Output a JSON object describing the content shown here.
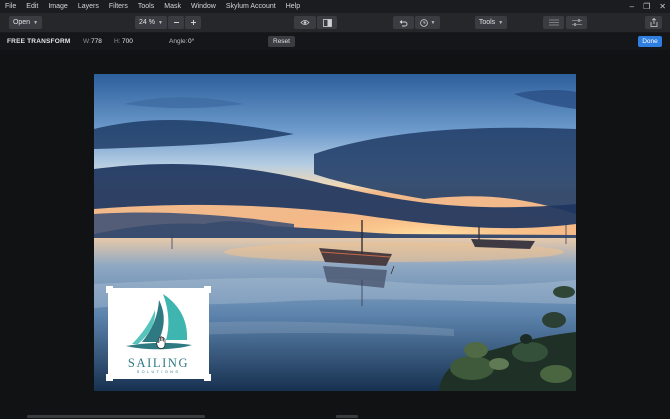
{
  "menu": [
    "File",
    "Edit",
    "Image",
    "Layers",
    "Filters",
    "Tools",
    "Mask",
    "Window",
    "Skylum Account",
    "Help"
  ],
  "window_controls": {
    "minimize": "–",
    "maximize": "❐",
    "close": "✕"
  },
  "toolbar": {
    "open_label": "Open",
    "zoom_value": "24 %",
    "tools_label": "Tools"
  },
  "transform": {
    "title": "FREE TRANSFORM",
    "w_label": "W:",
    "w_value": "778",
    "h_label": "H:",
    "h_value": "700",
    "angle_label": "Angle:",
    "angle_value": "0°",
    "reset_label": "Reset",
    "done_label": "Done"
  },
  "logo": {
    "title": "SAILING",
    "subtitle": "SOLUTIONS",
    "color": "#2f7a82",
    "accent": "#3fb5b0"
  },
  "colors": {
    "accent_blue": "#2f7fe0",
    "app_background": "#111214",
    "toolbar": "#26272b"
  }
}
